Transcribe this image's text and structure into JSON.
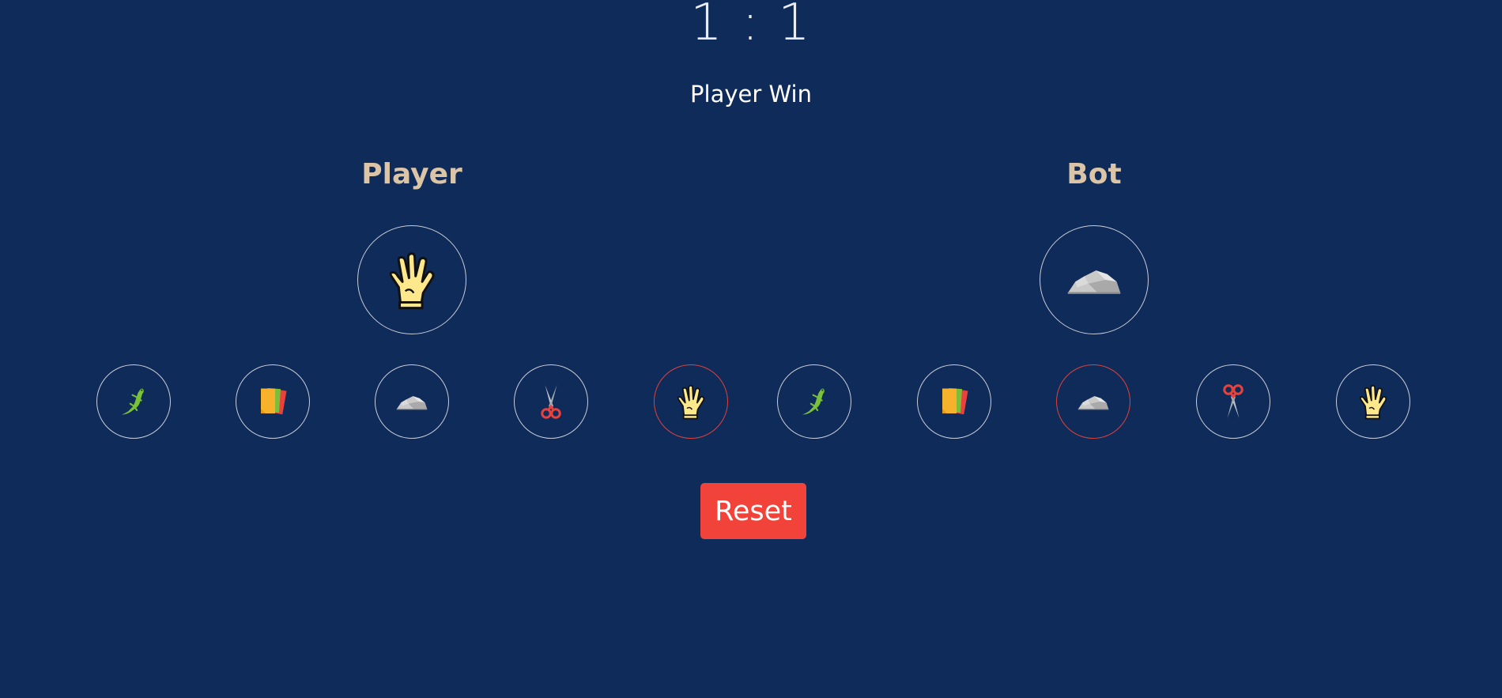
{
  "score": {
    "text": "1 : 1"
  },
  "result": "Player Win",
  "player": {
    "label": "Player",
    "choice_icon": "spock-hand-icon",
    "options": [
      {
        "icon": "lizard-icon",
        "selected": false
      },
      {
        "icon": "paper-icon",
        "selected": false
      },
      {
        "icon": "rock-icon",
        "selected": false
      },
      {
        "icon": "scissors-icon",
        "selected": false
      },
      {
        "icon": "spock-hand-icon",
        "selected": true
      }
    ]
  },
  "bot": {
    "label": "Bot",
    "choice_icon": "rock-icon",
    "options": [
      {
        "icon": "lizard-icon",
        "selected": false
      },
      {
        "icon": "paper-icon",
        "selected": false
      },
      {
        "icon": "rock-icon",
        "selected": true
      },
      {
        "icon": "scissors-icon",
        "selected": false
      },
      {
        "icon": "spock-hand-icon",
        "selected": false
      }
    ]
  },
  "reset_label": "Reset",
  "colors": {
    "background": "#0f2b5a",
    "label": "#dcc4a6",
    "selected_border": "#e0413a",
    "reset_button": "#f1433a"
  }
}
